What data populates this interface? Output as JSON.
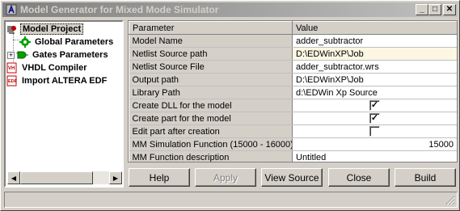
{
  "window": {
    "title": "Model Generator for Mixed Mode Simulator",
    "controls": {
      "minimize": "_",
      "maximize": "□",
      "close": "✕"
    }
  },
  "tree": {
    "items": [
      {
        "label": "Model Project",
        "icon": "project-icon",
        "selected": true
      },
      {
        "label": "Global Parameters",
        "icon": "parameters-icon"
      },
      {
        "label": "Gates Parameters",
        "icon": "gate-icon",
        "expander": "+"
      },
      {
        "label": "VHDL Compiler",
        "icon": "vhdl-icon"
      },
      {
        "label": "Import ALTERA EDF",
        "icon": "edf-icon"
      }
    ]
  },
  "grid": {
    "headers": {
      "parameter": "Parameter",
      "value": "Value"
    },
    "rows": [
      {
        "param": "Model Name",
        "value": "adder_subtractor"
      },
      {
        "param": "Netlist Source path",
        "value": "D:\\EDWinXP\\Job"
      },
      {
        "param": "Netlist Source File",
        "value": "adder_subtractor.wrs"
      },
      {
        "param": "Output path",
        "value": "D:\\EDWinXP\\Job"
      },
      {
        "param": "Library Path",
        "value": "d:\\EDWin Xp Source"
      },
      {
        "param": "Create DLL for the model",
        "checked": true
      },
      {
        "param": "Create part for the model",
        "checked": true
      },
      {
        "param": "Edit part after creation",
        "checked": false
      },
      {
        "param": "MM Simulation Function (15000 - 16000)",
        "value": "15000"
      },
      {
        "param": "MM Function description",
        "value": "Untitled"
      }
    ]
  },
  "buttons": {
    "help": "Help",
    "apply": "Apply",
    "view_source": "View Source",
    "close": "Close",
    "build": "Build"
  }
}
